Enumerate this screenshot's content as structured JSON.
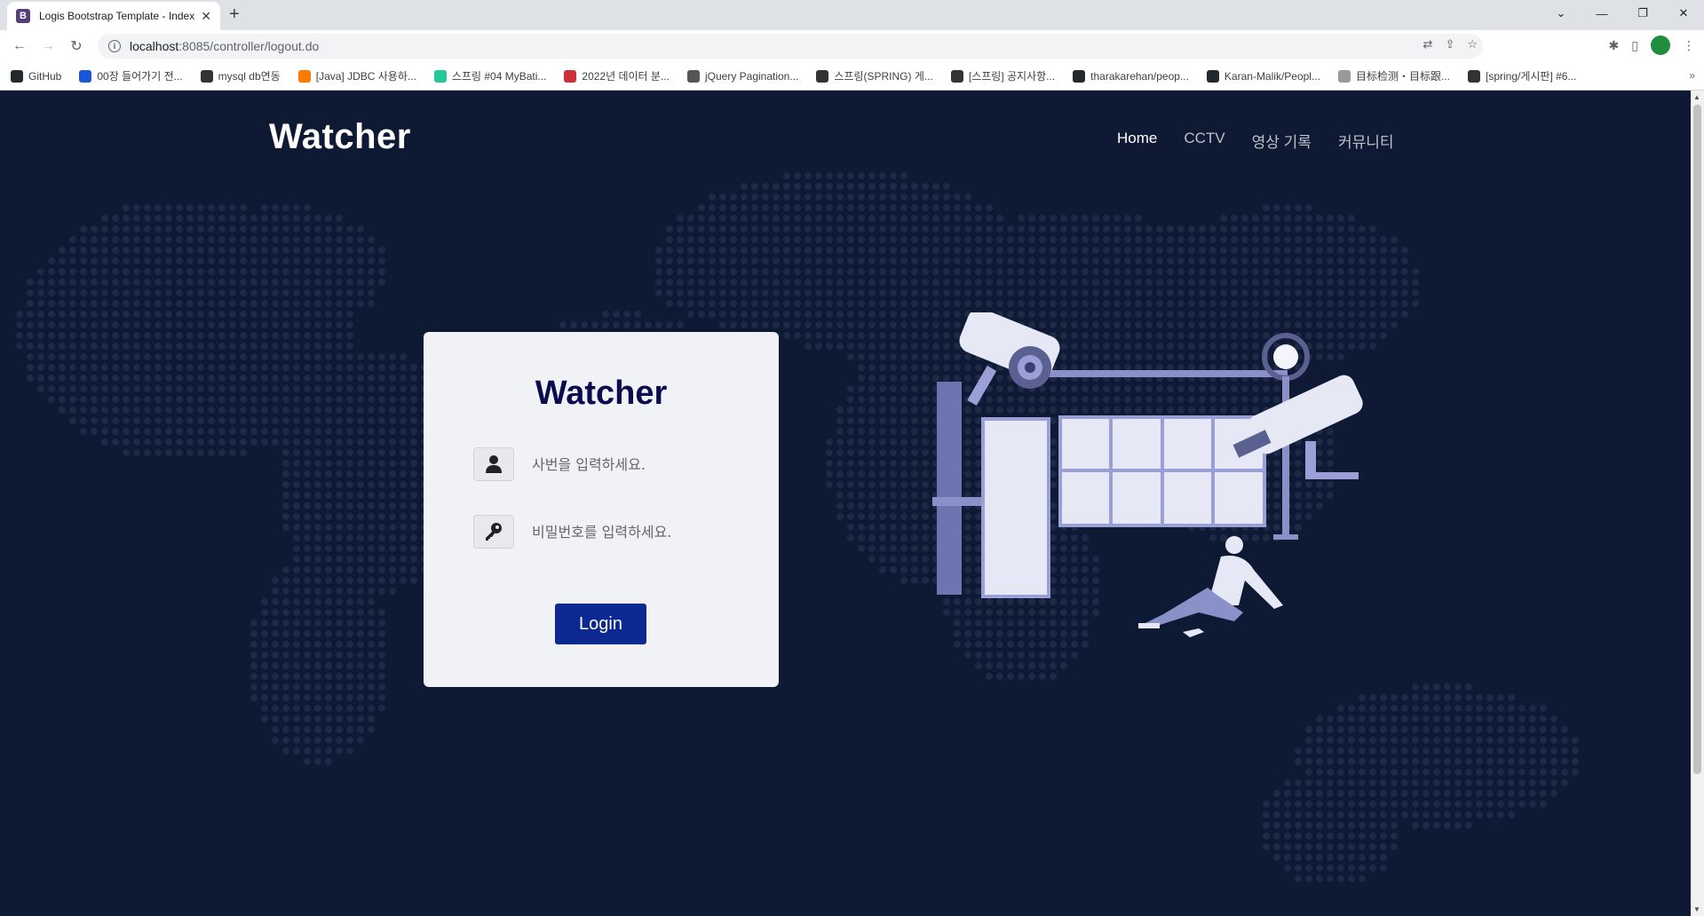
{
  "browser": {
    "tab_title": "Logis Bootstrap Template - Index",
    "tab_favicon": "B",
    "new_tab": "+",
    "url_host": "localhost",
    "url_path": ":8085/controller/logout.do",
    "bookmarks": [
      {
        "label": "GitHub",
        "icon": "github-icon",
        "color": "#24292e"
      },
      {
        "label": "00장 들어가기 전...",
        "icon": "book-icon",
        "color": "#1a56db"
      },
      {
        "label": "mysql db연동",
        "icon": "dots-icon",
        "color": "#333333"
      },
      {
        "label": "[Java] JDBC 사용하...",
        "icon": "v-icon",
        "color": "#ff7a00"
      },
      {
        "label": "스프링 #04 MyBati...",
        "icon": "v-icon",
        "color": "#20c997"
      },
      {
        "label": "2022년 데이터 분...",
        "icon": "flag-icon",
        "color": "#cd2e3a"
      },
      {
        "label": "jQuery Pagination...",
        "icon": "globe-icon",
        "color": "#555555"
      },
      {
        "label": "스프링(SPRING) 게...",
        "icon": "dots-icon",
        "color": "#333333"
      },
      {
        "label": "[스프링] 공지사항...",
        "icon": "dots-icon",
        "color": "#333333"
      },
      {
        "label": "tharakarehan/peop...",
        "icon": "github-icon",
        "color": "#24292e"
      },
      {
        "label": "Karan-Malik/Peopl...",
        "icon": "github-icon",
        "color": "#24292e"
      },
      {
        "label": "目标检测・目标跟...",
        "icon": "dots-icon",
        "color": "#999999"
      },
      {
        "label": "[spring/게시판] #6...",
        "icon": "dots-icon",
        "color": "#333333"
      }
    ],
    "bookmarks_more": "»"
  },
  "site": {
    "logo": "Watcher",
    "nav": [
      {
        "label": "Home",
        "active": true
      },
      {
        "label": "CCTV",
        "active": false
      },
      {
        "label": "영상 기록",
        "active": false
      },
      {
        "label": "커뮤니티",
        "active": false
      }
    ]
  },
  "login": {
    "title": "Watcher",
    "id_placeholder": "사번을 입력하세요.",
    "pw_placeholder": "비밀번호를 입력하세요.",
    "button": "Login"
  },
  "colors": {
    "page_bg": "#0e1a34",
    "dots": "#1c2a48",
    "button": "#0c2991",
    "illustration": "#9aa0d6"
  }
}
